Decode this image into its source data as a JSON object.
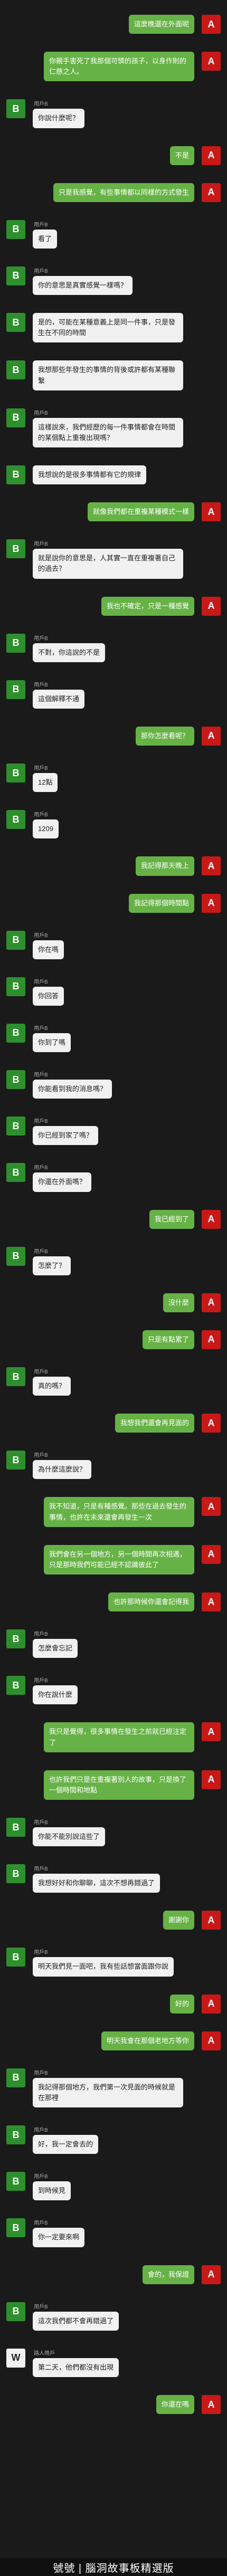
{
  "messages": [
    {
      "side": "right",
      "avatar": "A",
      "text": "這麼晚還在外面呢"
    },
    {
      "side": "right",
      "avatar": "A",
      "text": "你親手害死了我那個可憐的孩子，以身作則的仁慈之人。"
    },
    {
      "side": "left",
      "avatar": "B",
      "sender": "用戶B",
      "text": "你說什麼呢？"
    },
    {
      "side": "right",
      "avatar": "A",
      "text": "不是"
    },
    {
      "side": "right",
      "avatar": "A",
      "text": "只是我感覺，有些事情都以同樣的方式發生"
    },
    {
      "side": "left",
      "avatar": "B",
      "sender": "用戶B",
      "text": "看了"
    },
    {
      "side": "left",
      "avatar": "B",
      "sender": "用戶B",
      "text": "你的意思是真實感覺一樣嗎？"
    },
    {
      "side": "left",
      "avatar": "B",
      "text": "是的，可能在某種意義上是同一件事，只是發生在不同的時間"
    },
    {
      "side": "left",
      "avatar": "B",
      "text": "我想那些年發生的事情的背後或許都有某種聯繫"
    },
    {
      "side": "left",
      "avatar": "B",
      "sender": "用戶B",
      "text": "這樣說來，我們經歷的每一件事情都會在時間的某個點上重複出現嗎？"
    },
    {
      "side": "left",
      "avatar": "B",
      "text": "我想說的是很多事情都有它的規律"
    },
    {
      "side": "right",
      "avatar": "A",
      "text": "就像我們都在重複某種模式一樣"
    },
    {
      "side": "left",
      "avatar": "B",
      "sender": "用戶B",
      "text": "就是說你的意思是，人其實一直在重複著自己的過去？"
    },
    {
      "side": "right",
      "avatar": "A",
      "text": "我也不確定，只是一種感覺"
    },
    {
      "side": "left",
      "avatar": "B",
      "sender": "用戶B",
      "text": "不對，你這說的不是"
    },
    {
      "side": "left",
      "avatar": "B",
      "sender": "用戶B",
      "text": "這個解釋不通"
    },
    {
      "side": "right",
      "avatar": "A",
      "text": "那你怎麼看呢？"
    },
    {
      "side": "left",
      "avatar": "B",
      "sender": "用戶B",
      "text": "12點"
    },
    {
      "side": "left",
      "avatar": "B",
      "sender": "用戶B",
      "text": "1209"
    },
    {
      "side": "right",
      "avatar": "A",
      "text": "我記得那天晚上"
    },
    {
      "side": "right",
      "avatar": "A",
      "text": "我記得那個時間點"
    },
    {
      "side": "left",
      "avatar": "B",
      "sender": "用戶B",
      "text": "你在嗎"
    },
    {
      "side": "left",
      "avatar": "B",
      "sender": "用戶B",
      "text": "你回答"
    },
    {
      "side": "left",
      "avatar": "B",
      "sender": "用戶B",
      "text": "你到了嗎"
    },
    {
      "side": "left",
      "avatar": "B",
      "sender": "用戶B",
      "text": "你能看到我的消息嗎？"
    },
    {
      "side": "left",
      "avatar": "B",
      "sender": "用戶B",
      "text": "你已經到家了嗎？"
    },
    {
      "side": "left",
      "avatar": "B",
      "sender": "用戶B",
      "text": "你還在外面嗎？"
    },
    {
      "side": "right",
      "avatar": "A",
      "text": "我已經到了"
    },
    {
      "side": "left",
      "avatar": "B",
      "sender": "用戶B",
      "text": "怎麼了？"
    },
    {
      "side": "right",
      "avatar": "A",
      "text": "沒什麼"
    },
    {
      "side": "right",
      "avatar": "A",
      "text": "只是有點累了"
    },
    {
      "side": "left",
      "avatar": "B",
      "sender": "用戶B",
      "text": "真的嗎？"
    },
    {
      "side": "right",
      "avatar": "A",
      "text": "我想我們還會再見面的"
    },
    {
      "side": "left",
      "avatar": "B",
      "sender": "用戶B",
      "text": "為什麼這麼說？"
    },
    {
      "side": "right",
      "avatar": "A",
      "text": "我不知道，只是有種感覺。那些在過去發生的事情，也許在未來還會再發生一次"
    },
    {
      "side": "right",
      "avatar": "A",
      "text": "我們會在另一個地方，另一個時間再次相遇，只是那時我們可能已經不認識彼此了"
    },
    {
      "side": "right",
      "avatar": "A",
      "text": "也許那時候你還會記得我"
    },
    {
      "side": "left",
      "avatar": "B",
      "sender": "用戶B",
      "text": "怎麼會忘記"
    },
    {
      "side": "left",
      "avatar": "B",
      "sender": "用戶B",
      "text": "你在說什麼"
    },
    {
      "side": "right",
      "avatar": "A",
      "text": "我只是覺得，很多事情在發生之前就已經注定了"
    },
    {
      "side": "right",
      "avatar": "A",
      "text": "也許我們只是在重複著別人的故事，只是換了一個時間和地點"
    },
    {
      "side": "left",
      "avatar": "B",
      "sender": "用戶B",
      "text": "你能不能別說這些了"
    },
    {
      "side": "left",
      "avatar": "B",
      "sender": "用戶B",
      "text": "我想好好和你聊聊，這次不想再錯過了"
    },
    {
      "side": "right",
      "avatar": "A",
      "text": "謝謝你"
    },
    {
      "side": "left",
      "avatar": "B",
      "sender": "用戶B",
      "text": "明天我們見一面吧，我有些話想當面跟你說"
    },
    {
      "side": "right",
      "avatar": "A",
      "text": "好的"
    },
    {
      "side": "right",
      "avatar": "A",
      "text": "明天我會在那個老地方等你"
    },
    {
      "side": "left",
      "avatar": "B",
      "sender": "用戶B",
      "text": "我記得那個地方，我們第一次見面的時候就是在那裡"
    },
    {
      "side": "left",
      "avatar": "B",
      "sender": "用戶B",
      "text": "好，我一定會去的"
    },
    {
      "side": "left",
      "avatar": "B",
      "sender": "用戶B",
      "text": "到時候見"
    },
    {
      "side": "left",
      "avatar": "B",
      "sender": "用戶B",
      "text": "你一定要來啊"
    },
    {
      "side": "right",
      "avatar": "A",
      "text": "會的，我保證"
    },
    {
      "side": "left",
      "avatar": "B",
      "sender": "用戶B",
      "text": "這次我們都不會再錯過了"
    },
    {
      "side": "left",
      "avatar": "W",
      "sender": "路人用戶",
      "text": "第二天，他們都沒有出現"
    },
    {
      "side": "right",
      "avatar": "A",
      "text": "你還在嗎"
    }
  ],
  "watermark": "號號 | 腦洞故事板精選版"
}
